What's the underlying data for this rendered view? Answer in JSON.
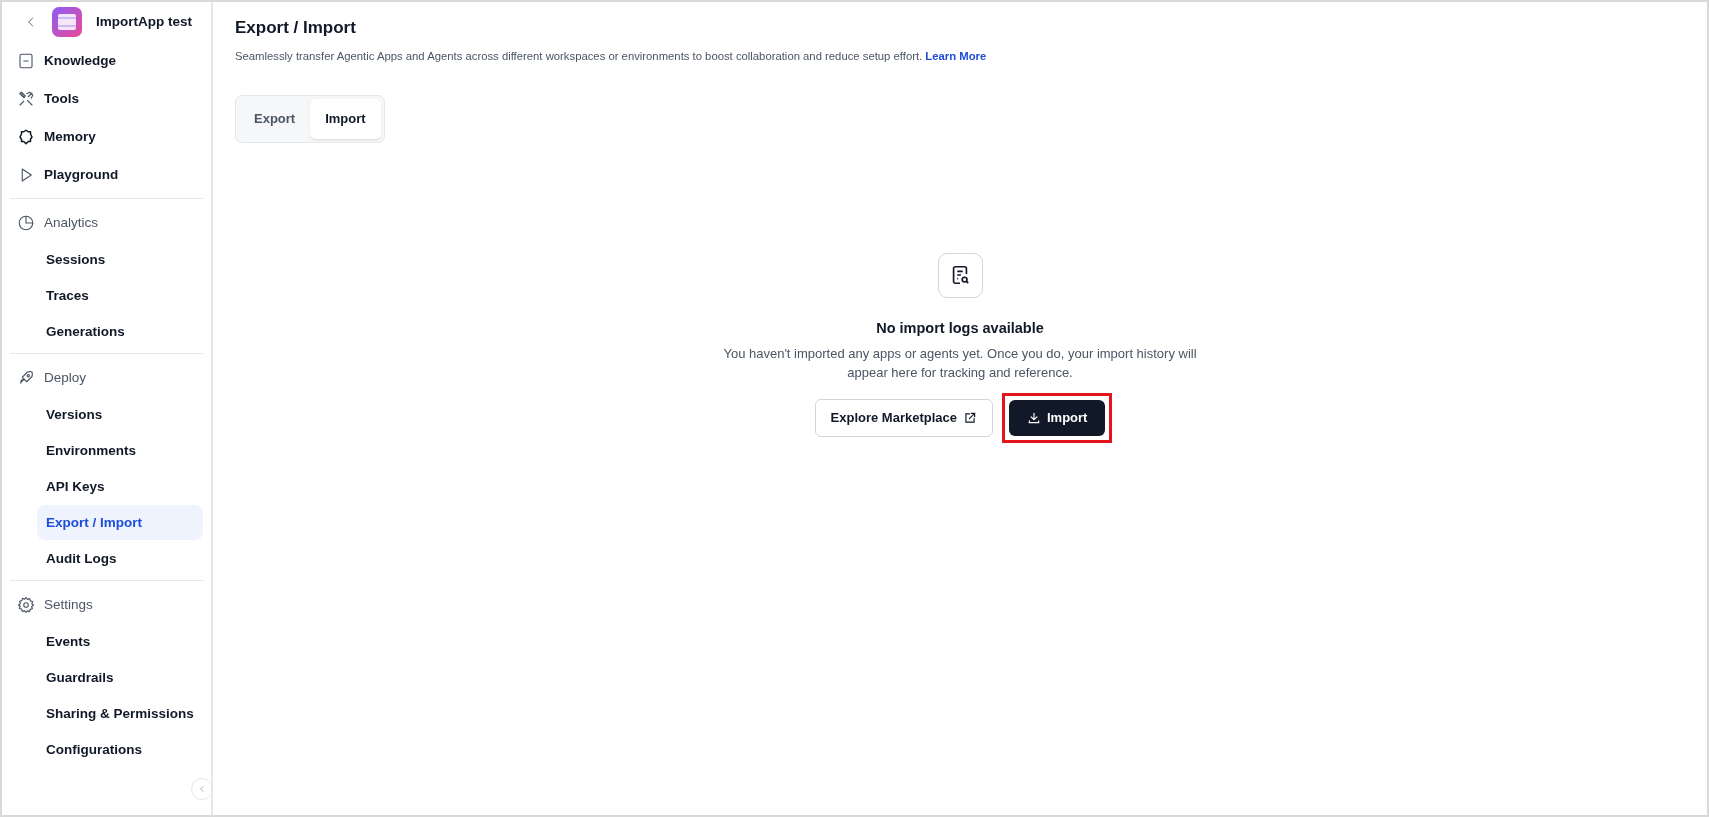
{
  "app": {
    "title": "ImportApp test"
  },
  "sidebar": {
    "items": [
      {
        "label": "Knowledge",
        "selected": false
      },
      {
        "label": "Tools",
        "selected": false
      },
      {
        "label": "Memory",
        "selected": false
      },
      {
        "label": "Playground",
        "selected": false
      }
    ],
    "groups": [
      {
        "label": "Analytics",
        "items": [
          {
            "label": "Sessions",
            "selected": false
          },
          {
            "label": "Traces",
            "selected": false
          },
          {
            "label": "Generations",
            "selected": false
          }
        ]
      },
      {
        "label": "Deploy",
        "items": [
          {
            "label": "Versions",
            "selected": false
          },
          {
            "label": "Environments",
            "selected": false
          },
          {
            "label": "API Keys",
            "selected": false
          },
          {
            "label": "Export / Import",
            "selected": true
          },
          {
            "label": "Audit Logs",
            "selected": false
          }
        ]
      },
      {
        "label": "Settings",
        "items": [
          {
            "label": "Events",
            "selected": false
          },
          {
            "label": "Guardrails",
            "selected": false
          },
          {
            "label": "Sharing & Permissions",
            "selected": false
          },
          {
            "label": "Configurations",
            "selected": false
          }
        ]
      }
    ]
  },
  "page": {
    "title": "Export / Import",
    "description": "Seamlessly transfer Agentic Apps and Agents across different workspaces or environments to boost collaboration and reduce setup effort.",
    "link": "Learn More"
  },
  "tabs": [
    {
      "label": "Export",
      "selected": false
    },
    {
      "label": "Import",
      "selected": true
    }
  ],
  "empty_state": {
    "title": "No import logs available",
    "message": "You haven't imported any apps or agents yet. Once you do, your import history will appear here for tracking and reference."
  },
  "buttons": [
    {
      "kind": "outline",
      "label": "Explore Marketplace"
    },
    {
      "kind": "primary",
      "label": "Import",
      "highlighted": true
    }
  ]
}
